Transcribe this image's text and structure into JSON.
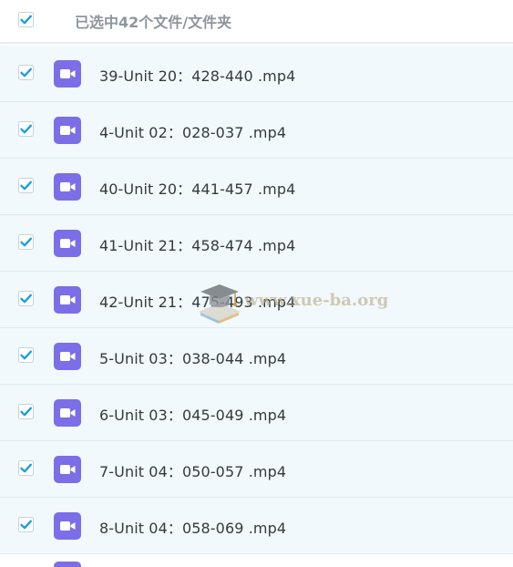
{
  "header": {
    "selected_label": "已选中42个文件/文件夹",
    "check_state": "checked"
  },
  "files": [
    {
      "name": "39-Unit 20：428-440 .mp4",
      "checked": true,
      "icon": "video-file-icon"
    },
    {
      "name": "4-Unit 02：028-037 .mp4",
      "checked": true,
      "icon": "video-file-icon"
    },
    {
      "name": "40-Unit 20：441-457 .mp4",
      "checked": true,
      "icon": "video-file-icon"
    },
    {
      "name": "41-Unit 21：458-474 .mp4",
      "checked": true,
      "icon": "video-file-icon"
    },
    {
      "name": "42-Unit 21：475-493 .mp4",
      "checked": true,
      "icon": "video-file-icon"
    },
    {
      "name": "5-Unit 03：038-044 .mp4",
      "checked": true,
      "icon": "video-file-icon"
    },
    {
      "name": "6-Unit 03：045-049 .mp4",
      "checked": true,
      "icon": "video-file-icon"
    },
    {
      "name": "7-Unit 04：050-057 .mp4",
      "checked": true,
      "icon": "video-file-icon"
    },
    {
      "name": "8-Unit 04：058-069 .mp4",
      "checked": true,
      "icon": "video-file-icon"
    }
  ],
  "watermark": {
    "text": "www.xue-ba.org"
  },
  "colors": {
    "check_blue": "#1e9de2",
    "icon_purple": "#7b6ee6",
    "row_background": "#f1f9fd",
    "header_text": "#8e959c"
  }
}
